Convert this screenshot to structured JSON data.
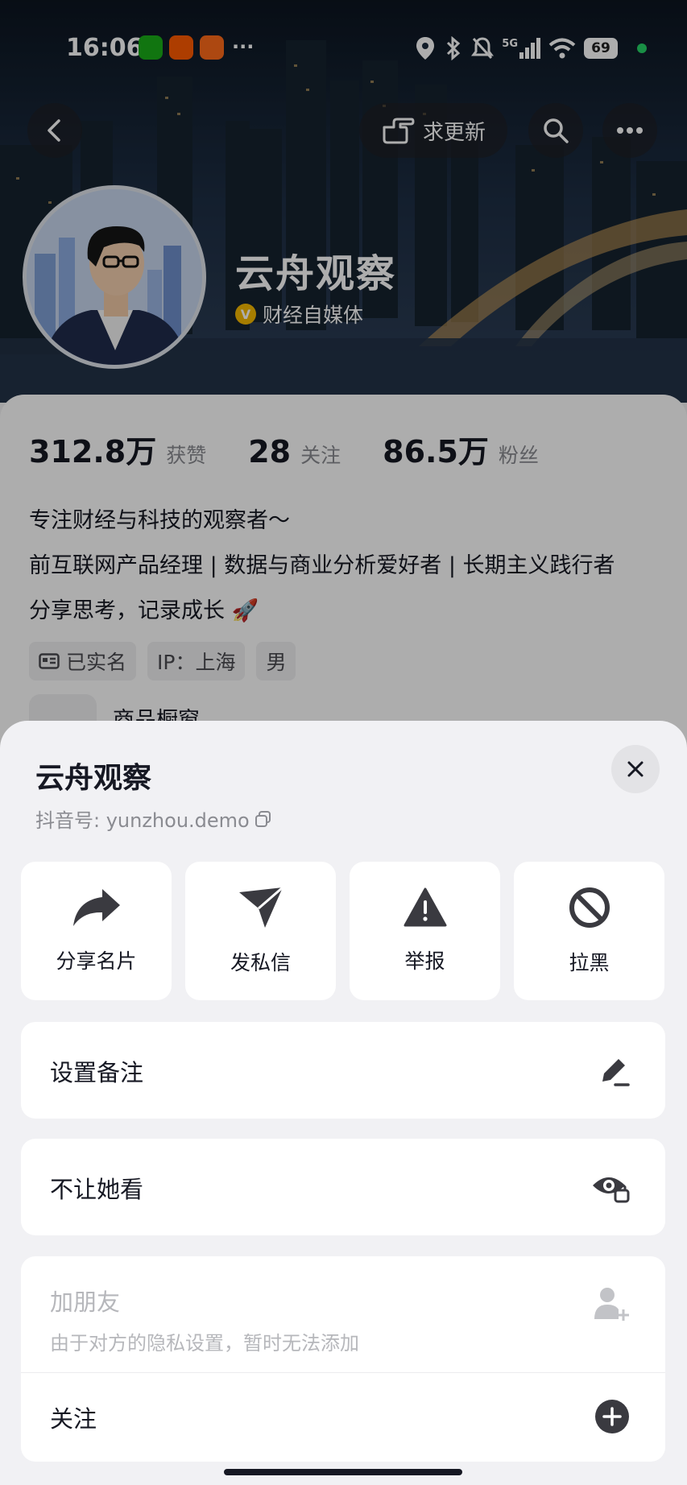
{
  "status_bar": {
    "time": "16:06",
    "network": "5G",
    "battery": "69",
    "app_icons": [
      "wechat-icon",
      "taobao-icon",
      "alipay-icon",
      "more-notifications-icon"
    ]
  },
  "header": {
    "request_update_label": "求更新"
  },
  "profile": {
    "name": "云舟观察",
    "verification": "财经自媒体",
    "verification_badge": "V",
    "stats": [
      {
        "value": "312.8万",
        "label": "获赞"
      },
      {
        "value": "28",
        "label": "关注"
      },
      {
        "value": "86.5万",
        "label": "粉丝"
      }
    ],
    "bio_lines": [
      "专注财经与科技的观察者～",
      "前互联网产品经理 | 数据与商业分析爱好者 | 长期主义践行者",
      "分享思考，记录成长 🚀"
    ],
    "tags": [
      "已实名",
      "IP：上海",
      "男"
    ],
    "shop_label": "商品橱窗"
  },
  "sheet": {
    "title": "云舟观察",
    "douyin_id": "抖音号: yunzhou.demo",
    "actions": [
      {
        "label": "分享名片",
        "icon": "share-icon"
      },
      {
        "label": "发私信",
        "icon": "send-icon"
      },
      {
        "label": "举报",
        "icon": "warning-icon"
      },
      {
        "label": "拉黑",
        "icon": "block-icon"
      }
    ],
    "set_remark": "设置备注",
    "hide_from": "不让她看",
    "add_friend": "加朋友",
    "add_friend_note": "由于对方的隐私设置，暂时无法添加",
    "follow": "关注"
  },
  "colors": {
    "verify_badge": "#f5b800",
    "sheet_bg": "#f1f1f4",
    "text": "#161823",
    "muted": "#8a8b91"
  }
}
